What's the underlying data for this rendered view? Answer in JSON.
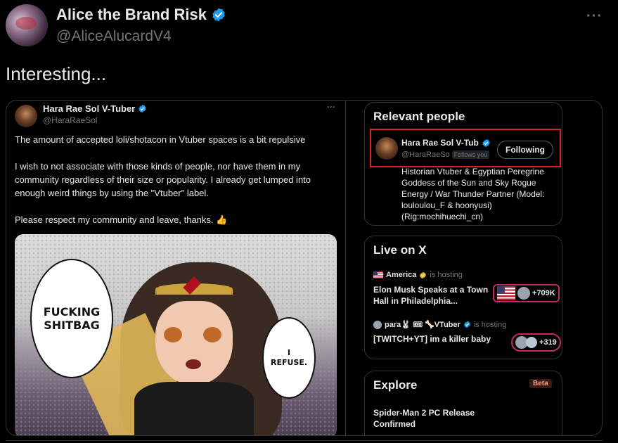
{
  "post": {
    "display_name": "Alice the Brand Risk",
    "handle": "@AliceAlucardV4",
    "more_icon": "more-horizontal-icon",
    "text": "Interesting..."
  },
  "embedded_tweet": {
    "name": "Hara Rae Sol V-Tuber",
    "handle": "@HaraRaeSol",
    "more": "···",
    "paragraphs": [
      "The amount of accepted loli/shotacon in Vtuber spaces is a bit repulsive",
      "I wish to not associate with those kinds of people, nor have them in my community regardless of their size or popularity. I already get lumped into enough weird things by using the \"Vtuber\" label.",
      "Please respect my community and leave, thanks. 👍"
    ],
    "manga": {
      "bubble_left": "FUCKING\nSHITBAG",
      "bubble_right": "I\nREFUSE."
    }
  },
  "sidebar": {
    "relevant": {
      "title": "Relevant people",
      "name": "Hara Rae Sol V-Tub",
      "handle": "@HaraRaeSo",
      "follows_you": "Follows you",
      "button": "Following",
      "bio": "Historian Vtuber & Egyptian Peregrine Goddess of the Sun and Sky Rogue Energy / War Thunder Partner (Model: louloulou_F & hoonyusi) (Rig:mochihuechi_cn)"
    },
    "live": {
      "title": "Live on X",
      "items": [
        {
          "host": "America",
          "hosting": "is hosting",
          "title": "Elon Musk Speaks at a Town Hall in Philadelphia...",
          "count": "+709K"
        },
        {
          "host": "para🐰 🎟 🦴VTuber",
          "hosting": "is hosting",
          "title": "[TWITCH+YT] im a killer baby",
          "count": "+319"
        }
      ]
    },
    "explore": {
      "title": "Explore",
      "badge": "Beta",
      "item": "Spider-Man 2 PC Release Confirmed"
    }
  },
  "colors": {
    "background": "#000000",
    "text": "#e7e9ea",
    "muted": "#71767b",
    "verified_blue": "#1d9bf0",
    "border": "#2f3336",
    "highlight_red": "#e0202a",
    "live_pink": "#c0286a"
  }
}
